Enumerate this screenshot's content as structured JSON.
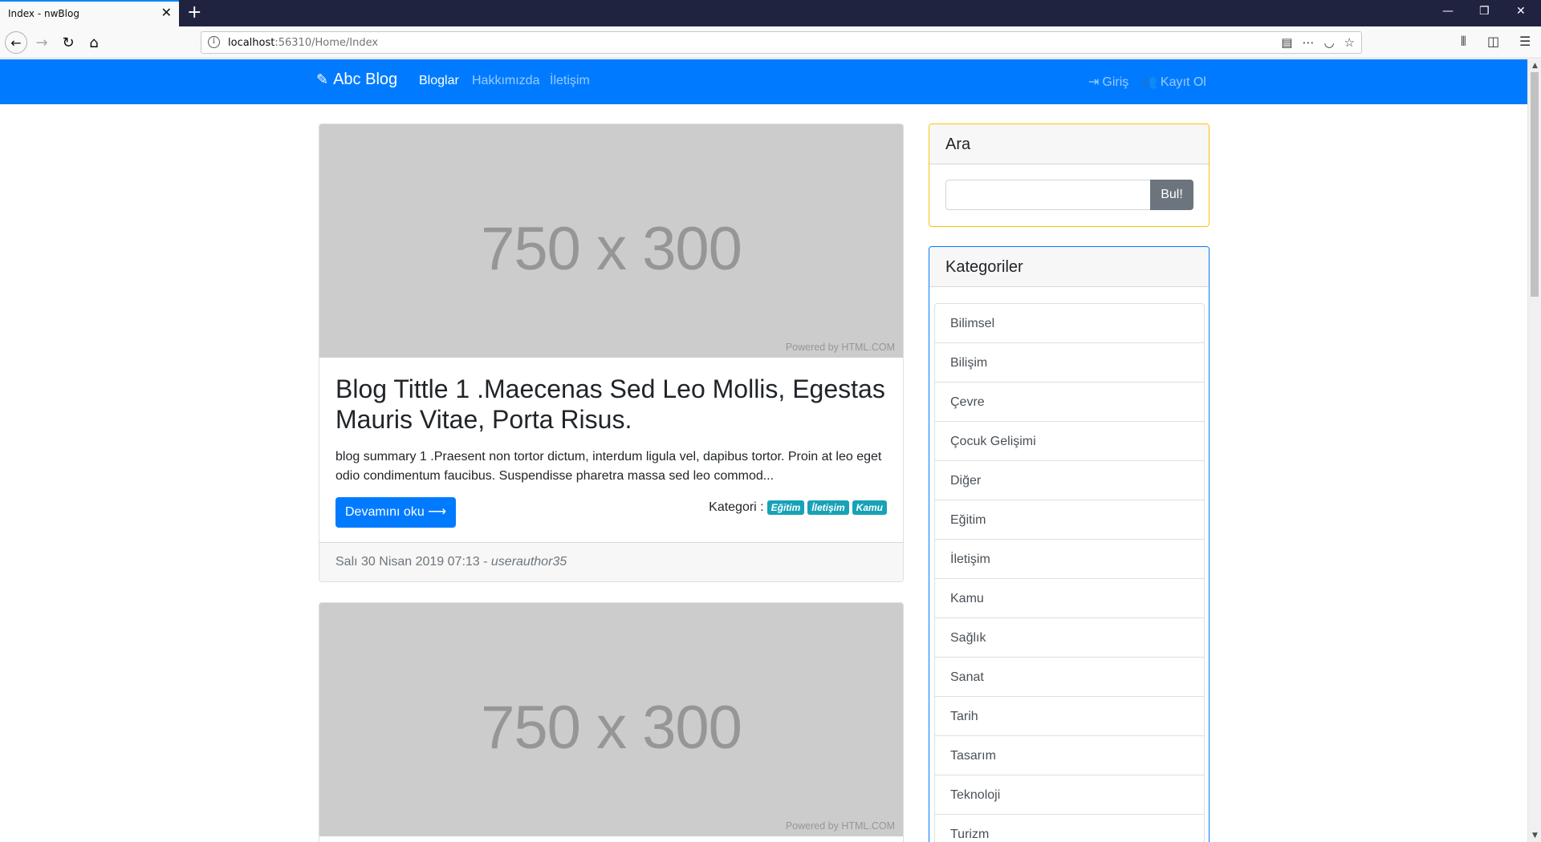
{
  "browser": {
    "tab_title": "Index - nwBlog",
    "url_host": "localhost",
    "url_rest": ":56310/Home/Index",
    "window_controls": [
      "—",
      "❐",
      "✕"
    ]
  },
  "site": {
    "brand": "Abc Blog",
    "nav": [
      {
        "label": "Bloglar"
      },
      {
        "label": "Hakkımızda"
      },
      {
        "label": "İletişim"
      }
    ],
    "login": "Giriş",
    "register": "Kayıt Ol",
    "primary_color": "#007bff"
  },
  "posts": [
    {
      "image_text": "750 x 300",
      "image_credit": "Powered by HTML.COM",
      "title": "Blog Tittle 1 .Maecenas Sed Leo Mollis, Egestas Mauris Vitae, Porta Risus.",
      "summary": "blog summary 1 .Praesent non tortor dictum, interdum ligula vel, dapibus tortor. Proin at leo eget odio condimentum faucibus. Suspendisse pharetra massa sed leo commod...",
      "read_more": "Devamını oku ⟶",
      "category_label": "Kategori :",
      "categories": [
        "Eğitim",
        "İletişim",
        "Kamu"
      ],
      "date": "Salı 30 Nisan 2019 07:13",
      "author": "userauthor35"
    },
    {
      "image_text": "750 x 300",
      "image_credit": "Powered by HTML.COM"
    }
  ],
  "sidebar": {
    "search_title": "Ara",
    "search_button": "Bul!",
    "search_value": "",
    "categories_title": "Kategoriler",
    "categories": [
      "Bilimsel",
      "Bilişim",
      "Çevre",
      "Çocuk Gelişimi",
      "Diğer",
      "Eğitim",
      "İletişim",
      "Kamu",
      "Sağlık",
      "Sanat",
      "Tarih",
      "Tasarım",
      "Teknoloji",
      "Turizm"
    ]
  }
}
